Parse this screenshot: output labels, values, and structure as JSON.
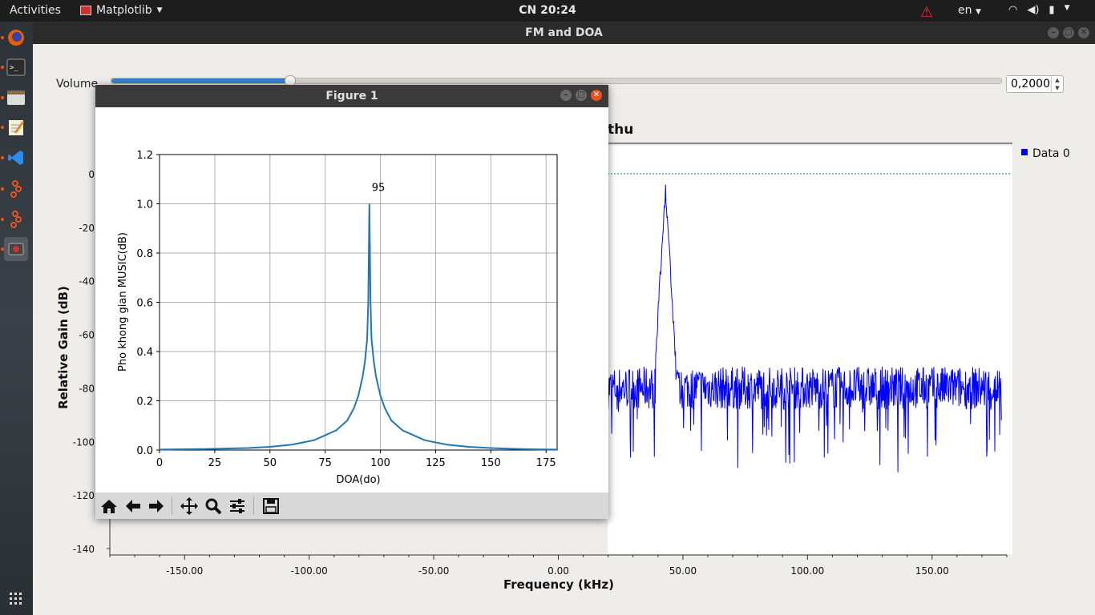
{
  "topbar": {
    "activities": "Activities",
    "app_name": "Matplotlib",
    "clock": "CN 20:24",
    "lang": "en"
  },
  "dock": {
    "items": [
      "firefox-icon",
      "terminal-icon",
      "files-icon",
      "text-editor-icon",
      "vscode-icon",
      "gnuradio-icon",
      "gnuradio-icon",
      "matplotlib-icon"
    ]
  },
  "main_window": {
    "title": "FM and DOA",
    "volume_label": "Volume",
    "volume_value_text": "0,2000",
    "volume_fraction": 0.2,
    "plot_title": "thu",
    "legend": "Data 0",
    "legend_color": "#0000ff"
  },
  "figure": {
    "title": "Figure 1",
    "toolbar": [
      "home-icon",
      "back-icon",
      "forward-icon",
      "pan-icon",
      "zoom-icon",
      "configure-icon",
      "save-icon"
    ]
  },
  "chart_data": [
    {
      "type": "line",
      "title": "",
      "xlabel": "DOA(do)",
      "ylabel": "Pho khong gian MUSIC(dB)",
      "xlim": [
        0,
        180
      ],
      "ylim": [
        0,
        1.2
      ],
      "xticks": [
        "0",
        "25",
        "50",
        "75",
        "100",
        "125",
        "150",
        "175"
      ],
      "yticks": [
        "0.0",
        "0.2",
        "0.4",
        "0.6",
        "0.8",
        "1.0",
        "1.2"
      ],
      "grid": true,
      "annotation": "95",
      "peak_x": 95,
      "peak_y": 1.0,
      "series": [
        {
          "color": "#1f77b4",
          "x": [
            0,
            20,
            40,
            50,
            60,
            70,
            80,
            85,
            88,
            90,
            92,
            93,
            94,
            94.5,
            95,
            95.5,
            96,
            97,
            98,
            100,
            102,
            105,
            110,
            120,
            130,
            140,
            150,
            160,
            170,
            180
          ],
          "y": [
            0.002,
            0.004,
            0.008,
            0.013,
            0.022,
            0.04,
            0.08,
            0.12,
            0.17,
            0.22,
            0.3,
            0.36,
            0.45,
            0.6,
            1.0,
            0.6,
            0.45,
            0.36,
            0.3,
            0.22,
            0.17,
            0.12,
            0.08,
            0.04,
            0.022,
            0.013,
            0.008,
            0.005,
            0.003,
            0.002
          ]
        }
      ]
    },
    {
      "type": "line",
      "title": "thu",
      "xlabel": "Frequency (kHz)",
      "ylabel": "Relative Gain (dB)",
      "xlim": [
        -180,
        180
      ],
      "ylim": [
        -140,
        0
      ],
      "xticks": [
        "-150.00",
        "-100.00",
        "-50.00",
        "0.00",
        "50.00",
        "100.00",
        "150.00"
      ],
      "yticks": [
        "0",
        "-20",
        "-40",
        "-60",
        "-80",
        "-100",
        "-120",
        "-140"
      ],
      "noise_floor_db": -80,
      "peak_khz": 43,
      "peak_db": -2,
      "series": [
        {
          "name": "Data 0",
          "color": "#0000ff"
        }
      ]
    }
  ]
}
